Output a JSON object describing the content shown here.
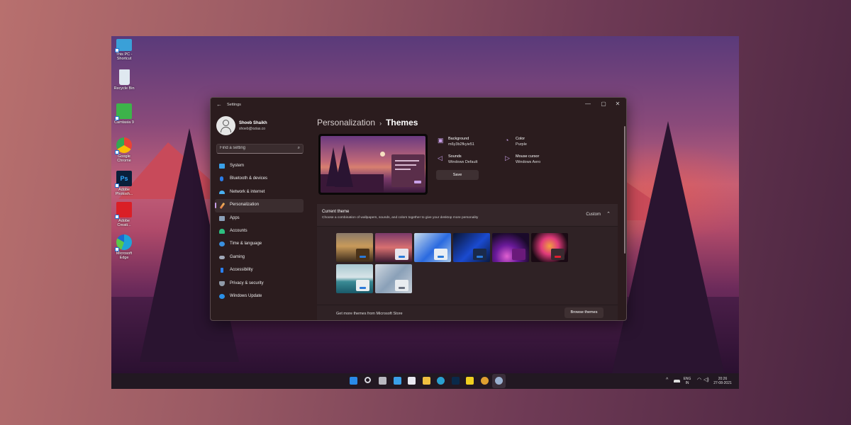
{
  "desktop": {
    "icons": [
      {
        "label": "This PC - Shortcut",
        "icon": "monitor-icon",
        "color": "#3aa0d8"
      },
      {
        "label": "Recycle Bin",
        "icon": "recycle-bin-icon",
        "color": "#dfe8f0"
      },
      {
        "label": "Camtasia 9",
        "icon": "camtasia-icon",
        "color": "#3db34a"
      },
      {
        "label": "Google Chrome",
        "icon": "chrome-icon",
        "color": "#e94235"
      },
      {
        "label": "Adobe Photosh...",
        "icon": "photoshop-icon",
        "color": "#0a1f3a"
      },
      {
        "label": "Adobe Creati...",
        "icon": "creative-cloud-icon",
        "color": "#da1f26"
      },
      {
        "label": "Microsoft Edge",
        "icon": "edge-icon",
        "color": "#1fa3d8"
      }
    ]
  },
  "window": {
    "title": "Settings",
    "back_glyph": "←",
    "controls": {
      "minimize": "—",
      "maximize": "▢",
      "close": "✕"
    }
  },
  "profile": {
    "name": "Shoeb Shaikh",
    "email": "shoeb@ozias.co"
  },
  "search": {
    "placeholder": "Find a setting",
    "value": ""
  },
  "nav": {
    "items": [
      {
        "label": "System",
        "icon": "system-icon",
        "color": "#3aa0e8",
        "active": false
      },
      {
        "label": "Bluetooth & devices",
        "icon": "bluetooth-icon",
        "color": "#2a7ce8",
        "active": false
      },
      {
        "label": "Network & internet",
        "icon": "network-icon",
        "color": "#4ab0f0",
        "active": false
      },
      {
        "label": "Personalization",
        "icon": "brush-icon",
        "color": "#e89a50",
        "active": true
      },
      {
        "label": "Apps",
        "icon": "apps-icon",
        "color": "#8aa0b8",
        "active": false
      },
      {
        "label": "Accounts",
        "icon": "accounts-icon",
        "color": "#2ec080",
        "active": false
      },
      {
        "label": "Time & language",
        "icon": "globe-clock-icon",
        "color": "#3a90e0",
        "active": false
      },
      {
        "label": "Gaming",
        "icon": "gamepad-icon",
        "color": "#a0a8b8",
        "active": false
      },
      {
        "label": "Accessibility",
        "icon": "accessibility-icon",
        "color": "#2a80f0",
        "active": false
      },
      {
        "label": "Privacy & security",
        "icon": "shield-icon",
        "color": "#909aa8",
        "active": false
      },
      {
        "label": "Windows Update",
        "icon": "update-icon",
        "color": "#2a90e8",
        "active": false
      }
    ]
  },
  "breadcrumb": {
    "parent": "Personalization",
    "separator": "›",
    "current": "Themes"
  },
  "theme_props": [
    {
      "label": "Background",
      "value": "m6y3b2fkyie51",
      "icon": "image-icon",
      "glyph": "▣"
    },
    {
      "label": "Color",
      "value": "Purple",
      "icon": "palette-icon",
      "glyph": "◔"
    },
    {
      "label": "Sounds",
      "value": "Windows Default",
      "icon": "speaker-icon",
      "glyph": "◁"
    },
    {
      "label": "Mouse cursor",
      "value": "Windows Aero",
      "icon": "cursor-icon",
      "glyph": "▷"
    }
  ],
  "save_label": "Save",
  "current_theme": {
    "title": "Current theme",
    "description": "Choose a combination of wallpapers, sounds, and colors together to give your desktop more personality",
    "value": "Custom",
    "chevron": "⌃"
  },
  "themes": [
    {
      "name": "Sunset landscape",
      "bg": "linear-gradient(180deg,#8a7a6a 0%,#c89a5a 45%,#3a2a1a 100%)",
      "mini": "#4a3218",
      "bar": "#2a7ad8"
    },
    {
      "name": "Purple firewatch",
      "bg": "linear-gradient(180deg,#7a3a6a 0%,#d87070 50%,#3a1a30 100%)",
      "mini": "#e8e4ec",
      "bar": "#2a7ad8"
    },
    {
      "name": "Windows light",
      "bg": "linear-gradient(135deg,#c8dcec 0%,#2a6ae0 55%,#a8c8e8 100%)",
      "mini": "#e8eef4",
      "bar": "#2a7ad8"
    },
    {
      "name": "Windows dark",
      "bg": "linear-gradient(135deg,#0a1430 0%,#1a4ad0 55%,#0a1a40 100%)",
      "mini": "#1a2a4a",
      "bar": "#2a7ad8"
    },
    {
      "name": "Glow",
      "bg": "radial-gradient(circle at 40% 80%,#e060d0 0%,#6a1a9a 35%,#1a0a2a 75%)",
      "mini": "#6a1a7a",
      "bar": "#6a1a7a"
    },
    {
      "name": "Captured motion",
      "bg": "radial-gradient(circle at 50% 45%,#f0a040 0%,#e03a7a 35%,#1a0a14 75%)",
      "mini": "#3a2a30",
      "bar": "#e02030"
    },
    {
      "name": "Sunrise",
      "bg": "linear-gradient(180deg,#a8c8d0 0%,#d8e4e8 45%,#3a8a94 60%,#1a5a6a 100%)",
      "mini": "#e8eef0",
      "bar": "#2a7ad8"
    },
    {
      "name": "Flow",
      "bg": "linear-gradient(135deg,#d0d8e0 0%,#8aa0b8 50%,#c8d0d8 100%)",
      "mini": "#e8ecf0",
      "bar": "#6a7280"
    }
  ],
  "store": {
    "text": "Get more themes from Microsoft Store",
    "button": "Browse themes"
  },
  "taskbar": {
    "apps": [
      {
        "name": "start",
        "icon": "windows-logo-icon",
        "color": "#2a8ae8"
      },
      {
        "name": "search",
        "icon": "search-icon",
        "color": "#d8d8e0"
      },
      {
        "name": "task-view",
        "icon": "task-view-icon",
        "color": "#b8b8c0"
      },
      {
        "name": "widgets",
        "icon": "widgets-icon",
        "color": "#3aa0e8"
      },
      {
        "name": "store",
        "icon": "store-icon",
        "color": "#e8e8f0"
      },
      {
        "name": "file-explorer",
        "icon": "folder-icon",
        "color": "#f0c040"
      },
      {
        "name": "edge",
        "icon": "edge-icon",
        "color": "#2aa0d0"
      },
      {
        "name": "photoshop",
        "icon": "photoshop-icon",
        "color": "#0a2a4a"
      },
      {
        "name": "sticky-notes",
        "icon": "sticky-notes-icon",
        "color": "#f0d020"
      },
      {
        "name": "chrome",
        "icon": "chrome-icon",
        "color": "#e0a030"
      },
      {
        "name": "settings",
        "icon": "settings-gear-icon",
        "color": "#9ab0d0"
      }
    ],
    "tray": {
      "chevron": "^",
      "language_line1": "ENG",
      "language_line2": "IN",
      "wifi": "wifi",
      "volume": "volume",
      "time": "20:26",
      "date": "27-08-2021"
    }
  }
}
